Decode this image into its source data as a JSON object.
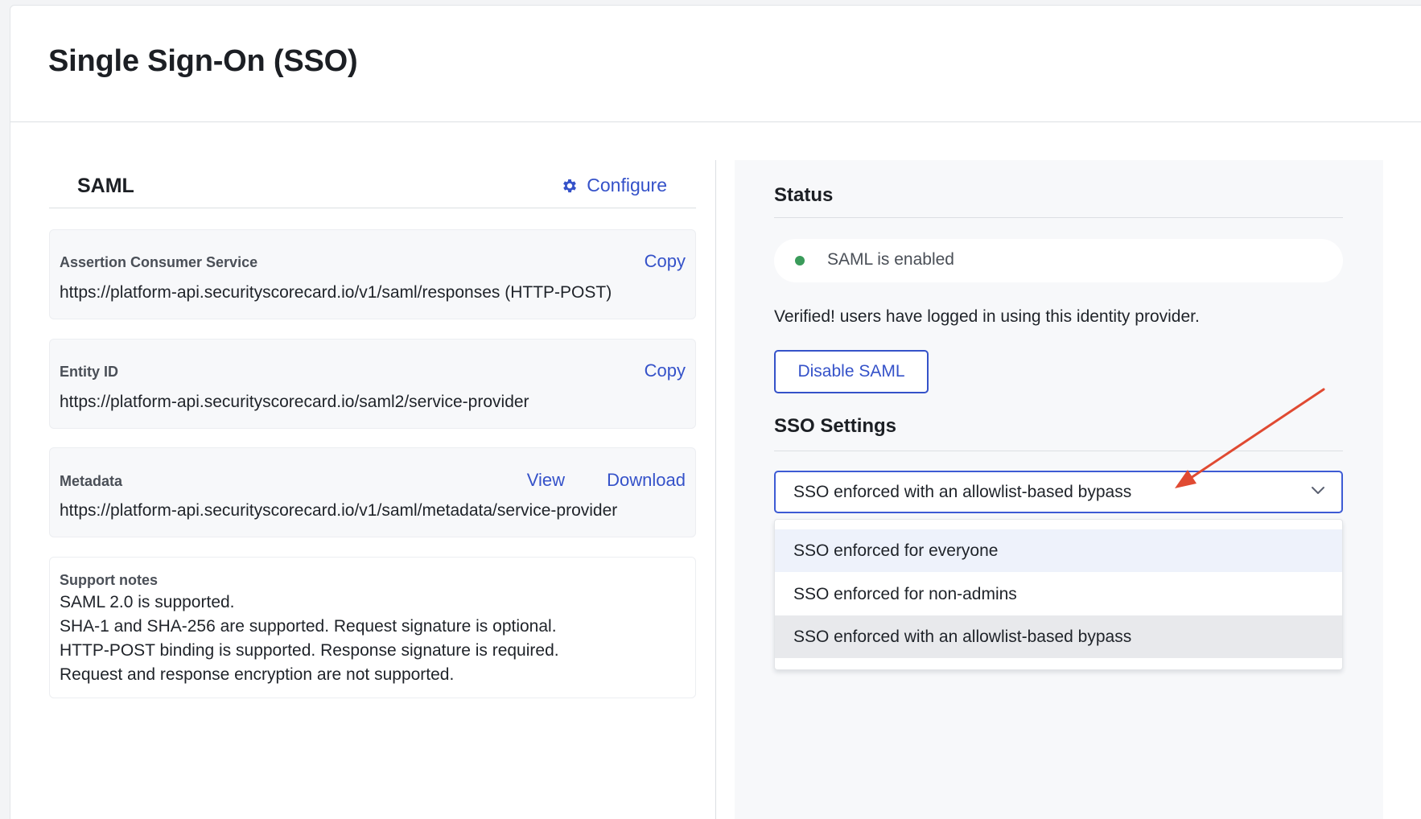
{
  "page": {
    "title": "Single Sign-On (SSO)"
  },
  "saml": {
    "title": "SAML",
    "configure_label": "Configure",
    "acs": {
      "label": "Assertion Consumer Service",
      "copy_label": "Copy",
      "value": "https://platform-api.securityscorecard.io/v1/saml/responses (HTTP-POST)"
    },
    "entity": {
      "label": "Entity ID",
      "copy_label": "Copy",
      "value": "https://platform-api.securityscorecard.io/saml2/service-provider"
    },
    "metadata": {
      "label": "Metadata",
      "view_label": "View",
      "download_label": "Download",
      "value": "https://platform-api.securityscorecard.io/v1/saml/metadata/service-provider"
    },
    "notes": {
      "label": "Support notes",
      "lines": [
        "SAML 2.0 is supported.",
        "SHA-1 and SHA-256 are supported. Request signature is optional.",
        "HTTP-POST binding is supported. Response signature is required.",
        "Request and response encryption are not supported."
      ]
    }
  },
  "status": {
    "title": "Status",
    "pill_text": "SAML is enabled",
    "verified_text": "Verified! users have logged in using this identity provider.",
    "disable_label": "Disable SAML"
  },
  "sso_settings": {
    "title": "SSO Settings",
    "selected": "SSO enforced with an allowlist-based bypass",
    "options": [
      "SSO enforced for everyone",
      "SSO enforced for non-admins",
      "SSO enforced with an allowlist-based bypass"
    ]
  },
  "colors": {
    "accent": "#3552c9",
    "status_green": "#3a9b5a",
    "annotation_arrow": "#e04a32"
  },
  "icons": {
    "configure": "gear-icon",
    "select": "chevron-down-icon",
    "status": "status-dot-icon"
  }
}
